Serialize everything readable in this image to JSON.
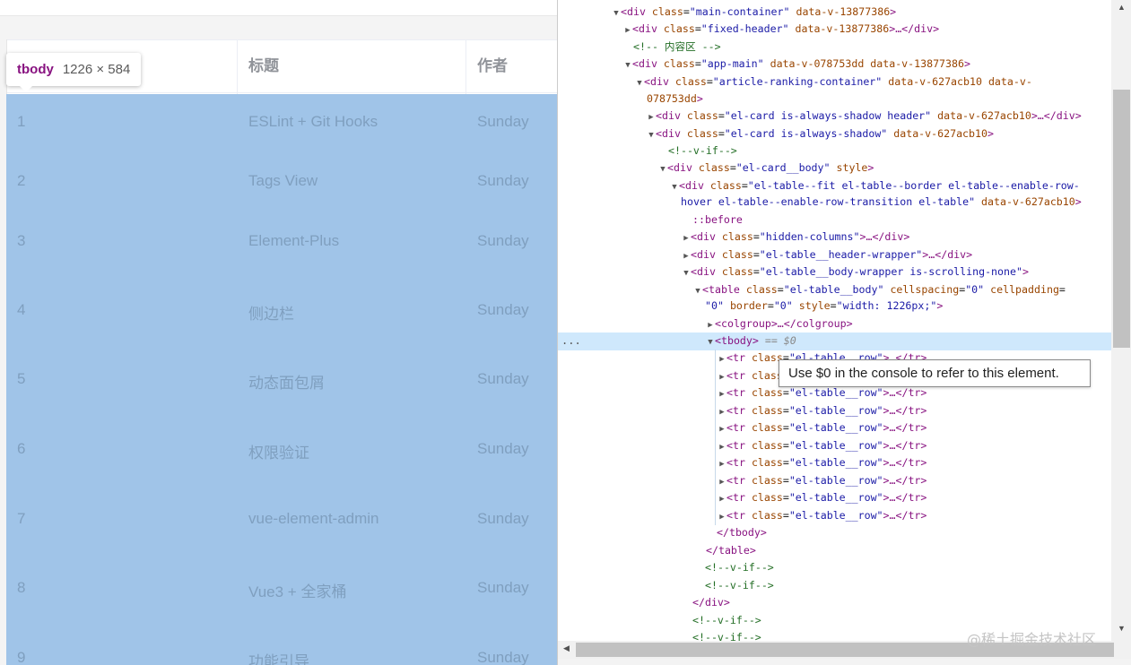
{
  "preview": {
    "tooltip": {
      "tag": "tbody",
      "size": "1226 × 584"
    },
    "headers": {
      "title": "标题",
      "author": "作者"
    },
    "rows": [
      {
        "rank": "1",
        "title": "ESLint + Git Hooks",
        "author": "Sunday"
      },
      {
        "rank": "2",
        "title": "Tags View",
        "author": "Sunday"
      },
      {
        "rank": "3",
        "title": "Element-Plus",
        "author": "Sunday"
      },
      {
        "rank": "4",
        "title": "侧边栏",
        "author": "Sunday"
      },
      {
        "rank": "5",
        "title": "动态面包屑",
        "author": "Sunday"
      },
      {
        "rank": "6",
        "title": "权限验证",
        "author": "Sunday"
      },
      {
        "rank": "7",
        "title": "vue-element-admin",
        "author": "Sunday"
      },
      {
        "rank": "8",
        "title": "Vue3 + 全家桶",
        "author": "Sunday"
      },
      {
        "rank": "9",
        "title": "功能引导",
        "author": "Sunday"
      }
    ],
    "overlay_color": "#a0c4e8"
  },
  "devtools": {
    "console_tooltip": "Use $0 in the console to refer to this element.",
    "selected_marker": "== $0",
    "selected_dots": "...",
    "lines": [
      {
        "tw": "▼",
        "tag": "div",
        "attrs": [
          [
            "class",
            "main-container"
          ],
          [
            "data-v-13877386",
            null
          ]
        ],
        "tail": ">"
      },
      {
        "tw": "▶",
        "tag": "div",
        "attrs": [
          [
            "class",
            "fixed-header"
          ],
          [
            "data-v-13877386",
            null
          ]
        ],
        "tail": ">…</div>"
      },
      {
        "comment": "<!-- 内容区 -->"
      },
      {
        "tw": "▼",
        "tag": "div",
        "attrs": [
          [
            "class",
            "app-main"
          ],
          [
            "data-v-078753dd",
            null
          ],
          [
            "data-v-13877386",
            null
          ]
        ],
        "tail": ">"
      },
      {
        "tw": "▼",
        "tag": "div",
        "attrs": [
          [
            "class",
            "article-ranking-container"
          ],
          [
            "data-v-627acb10",
            null
          ],
          [
            "data-v-",
            null
          ]
        ],
        "tail": ""
      },
      {
        "text": "078753dd",
        "cls": "an",
        "tail": ">"
      },
      {
        "tw": "▶",
        "tag": "div",
        "attrs": [
          [
            "class",
            "el-card is-always-shadow header"
          ],
          [
            "data-v-627acb10",
            null
          ]
        ],
        "tail": ">…</div>"
      },
      {
        "tw": "▼",
        "tag": "div",
        "attrs": [
          [
            "class",
            "el-card is-always-shadow"
          ],
          [
            "data-v-627acb10",
            null
          ]
        ],
        "tail": ">"
      },
      {
        "comment": "<!--v-if-->"
      },
      {
        "tw": "▼",
        "tag": "div",
        "attrs": [
          [
            "class",
            "el-card__body"
          ],
          [
            "style",
            null
          ]
        ],
        "tail": ">"
      },
      {
        "tw": "▼",
        "tag": "div",
        "attrs": [
          [
            "class",
            "el-table--fit el-table--border el-table--enable-row-"
          ]
        ],
        "open_quote_only": true,
        "tail": ""
      },
      {
        "text": "hover el-table--enable-row-transition el-table\"",
        "cls": "av",
        "suffix_attr": "data-v-627acb10",
        "tail": ">"
      },
      {
        "pseudo": "::before"
      },
      {
        "tw": "▶",
        "tag": "div",
        "attrs": [
          [
            "class",
            "hidden-columns"
          ]
        ],
        "tail": ">…</div>"
      },
      {
        "tw": "▶",
        "tag": "div",
        "attrs": [
          [
            "class",
            "el-table__header-wrapper"
          ]
        ],
        "tail": ">…</div>"
      },
      {
        "tw": "▼",
        "tag": "div",
        "attrs": [
          [
            "class",
            "el-table__body-wrapper is-scrolling-none"
          ]
        ],
        "tail": ">"
      },
      {
        "tw": "▼",
        "tag": "table",
        "attrs": [
          [
            "class",
            "el-table__body"
          ],
          [
            "cellspacing",
            "0"
          ],
          [
            "cellpadding",
            ""
          ]
        ],
        "cut_last": true,
        "tail": ""
      },
      {
        "text": "\"0\"",
        "cls": "av",
        "attrs_after": [
          [
            "border",
            "0"
          ],
          [
            "style",
            "width: 1226px;"
          ]
        ],
        "tail": ">"
      },
      {
        "tw": "▶",
        "tag": "colgroup",
        "attrs": [],
        "tail": ">…</colgroup>"
      },
      {
        "tw": "▼",
        "tag": "tbody",
        "attrs": [],
        "tail": ">",
        "selected": true
      },
      {
        "tw": "▶",
        "tag": "tr",
        "attrs": [
          [
            "class",
            "el-table__row"
          ]
        ],
        "tail": ">…</tr>"
      },
      {
        "tw": "▶",
        "tag": "tr",
        "attrs": [
          [
            "class",
            "el-table__row"
          ]
        ],
        "tail": ">…</tr>"
      },
      {
        "tw": "▶",
        "tag": "tr",
        "attrs": [
          [
            "class",
            "el-table__row"
          ]
        ],
        "tail": ">…</tr>"
      },
      {
        "tw": "▶",
        "tag": "tr",
        "attrs": [
          [
            "class",
            "el-table__row"
          ]
        ],
        "tail": ">…</tr>"
      },
      {
        "tw": "▶",
        "tag": "tr",
        "attrs": [
          [
            "class",
            "el-table__row"
          ]
        ],
        "tail": ">…</tr>"
      },
      {
        "tw": "▶",
        "tag": "tr",
        "attrs": [
          [
            "class",
            "el-table__row"
          ]
        ],
        "tail": ">…</tr>"
      },
      {
        "tw": "▶",
        "tag": "tr",
        "attrs": [
          [
            "class",
            "el-table__row"
          ]
        ],
        "tail": ">…</tr>"
      },
      {
        "tw": "▶",
        "tag": "tr",
        "attrs": [
          [
            "class",
            "el-table__row"
          ]
        ],
        "tail": ">…</tr>"
      },
      {
        "tw": "▶",
        "tag": "tr",
        "attrs": [
          [
            "class",
            "el-table__row"
          ]
        ],
        "tail": ">…</tr>"
      },
      {
        "tw": "▶",
        "tag": "tr",
        "attrs": [
          [
            "class",
            "el-table__row"
          ]
        ],
        "tail": ">…</tr>"
      },
      {
        "close": "</tbody>"
      },
      {
        "close": "</table>"
      },
      {
        "comment": "<!--v-if-->"
      },
      {
        "comment": "<!--v-if-->"
      },
      {
        "close": "</div>"
      },
      {
        "comment": "<!--v-if-->"
      },
      {
        "comment": "<!--v-if-->"
      }
    ]
  },
  "watermark": "@稀土掘金技术社区"
}
